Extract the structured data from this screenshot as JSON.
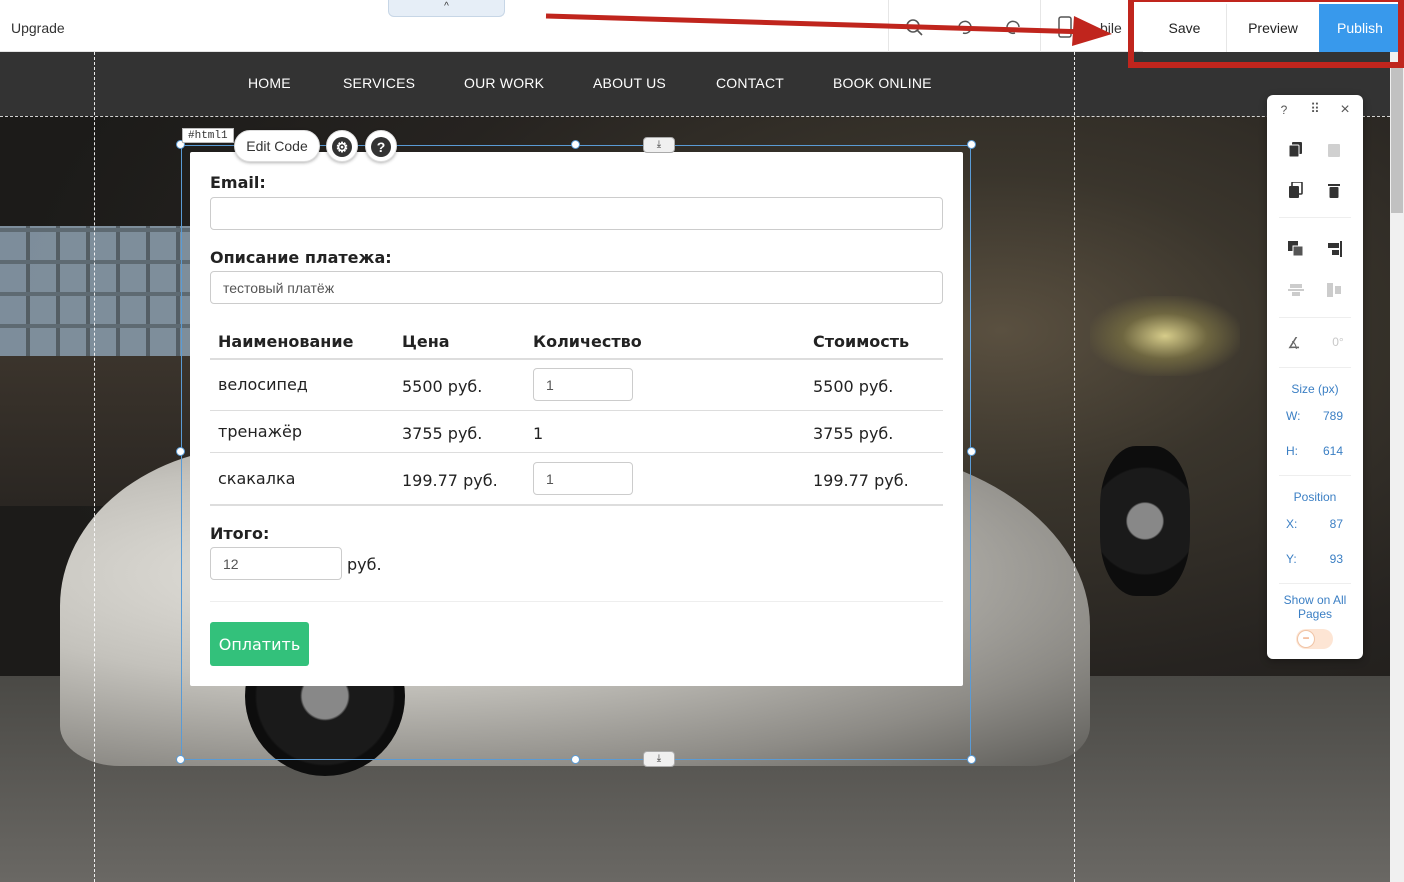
{
  "topbar": {
    "upgrade": "Upgrade",
    "collapse_icon": "^",
    "mobile_label": "bile",
    "save": "Save",
    "preview": "Preview",
    "publish": "Publish"
  },
  "site_nav": [
    "HOME",
    "SERVICES",
    "OUR WORK",
    "ABOUT US",
    "CONTACT",
    "BOOK ONLINE"
  ],
  "editor": {
    "element_id": "#html1",
    "edit_code": "Edit Code",
    "settings_icon": "gear-icon",
    "help_icon": "question-icon",
    "anchor_icon": "download-icon"
  },
  "form": {
    "email_label": "Email:",
    "email_value": "",
    "description_label": "Описание платежа:",
    "description_value": "тестовый платёж",
    "headers": [
      "Наименование",
      "Цена",
      "Количество",
      "Стоимость"
    ],
    "rows": [
      {
        "name": "велосипед",
        "price": "5500 руб.",
        "qty": "1",
        "qty_editable": true,
        "cost": "5500 руб."
      },
      {
        "name": "тренажёр",
        "price": "3755 руб.",
        "qty": "1",
        "qty_editable": false,
        "cost": "3755 руб."
      },
      {
        "name": "скакалка",
        "price": "199.77 руб.",
        "qty": "1",
        "qty_editable": true,
        "cost": "199.77 руб."
      }
    ],
    "total_label": "Итого:",
    "total_value": "12",
    "total_unit": "руб.",
    "pay_button": "Оплатить"
  },
  "tool_panel": {
    "help": "?",
    "drag": "⠿",
    "close": "×",
    "rotation": "0°",
    "size_title": "Size (px)",
    "w_label": "W:",
    "w_value": "789",
    "h_label": "H:",
    "h_value": "614",
    "position_title": "Position",
    "x_label": "X:",
    "x_value": "87",
    "y_label": "Y:",
    "y_value": "93",
    "show_all_line1": "Show on All",
    "show_all_line2": "Pages",
    "toggle_knob": "−"
  },
  "colors": {
    "publish": "#3899ec",
    "highlight_red": "#c0251d",
    "pay_green": "#33c17b",
    "nav_bg": "#333333"
  }
}
